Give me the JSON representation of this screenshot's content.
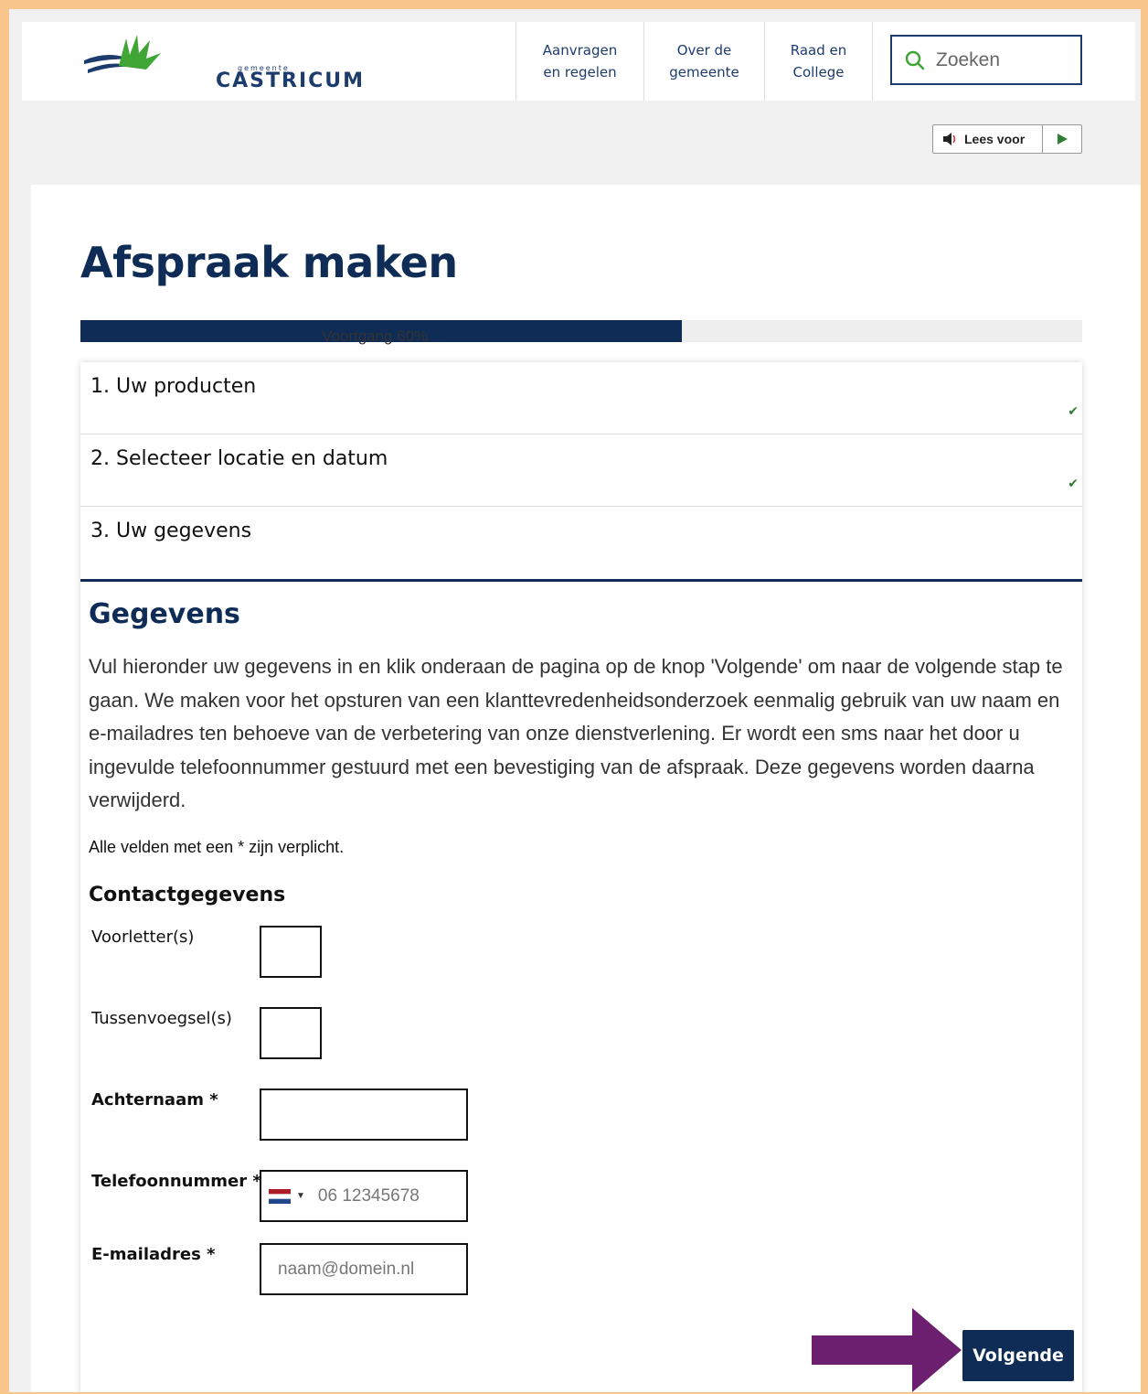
{
  "brand": {
    "logo_small": "gemeente",
    "logo_main": "CASTRICUM",
    "colors": {
      "navy": "#0e2c55",
      "green": "#3fa535",
      "frame": "#f8c68c",
      "arrow": "#6b1f6e"
    }
  },
  "nav": {
    "items": [
      {
        "label": "Aanvragen\nen regelen"
      },
      {
        "label": "Over de\ngemeente"
      },
      {
        "label": "Raad en\nCollege"
      }
    ],
    "search_placeholder": "Zoeken"
  },
  "readspeaker": {
    "label": "Lees voor",
    "icons": [
      "speaker-icon",
      "play-icon"
    ]
  },
  "page": {
    "title": "Afspraak maken",
    "progress_label": "Voortgang 60%",
    "progress_value": 0.6
  },
  "steps": [
    {
      "label": "1. Uw producten",
      "completed": true
    },
    {
      "label": "2. Selecteer locatie en datum",
      "completed": true
    },
    {
      "label": "3. Uw gegevens",
      "completed": false
    }
  ],
  "form": {
    "section_title": "Gegevens",
    "intro": "Vul hieronder uw gegevens in en klik onderaan de pagina op de knop 'Volgende' om naar de volgende stap te gaan. We maken voor het opsturen van een klanttevredenheidsonderzoek eenmalig gebruik van uw naam en e-mailadres ten behoeve van de verbetering van onze dienstverlening. Er wordt een sms naar het door u ingevulde telefoonnummer gestuurd met een bevestiging van de afspraak. Deze gegevens worden daarna verwijderd.",
    "required_note": "Alle velden met een * zijn verplicht.",
    "contact_title": "Contactgegevens",
    "fields": {
      "initials": {
        "label": "Voorletter(s)",
        "value": ""
      },
      "infix": {
        "label": "Tussenvoegsel(s)",
        "value": ""
      },
      "lastname": {
        "label": "Achternaam *",
        "value": ""
      },
      "phone": {
        "label": "Telefoonnummer *",
        "placeholder": "06 12345678",
        "country": "NL"
      },
      "email": {
        "label": "E-mailadres *",
        "placeholder": "naam@domein.nl"
      }
    },
    "next_label": "Volgende"
  }
}
